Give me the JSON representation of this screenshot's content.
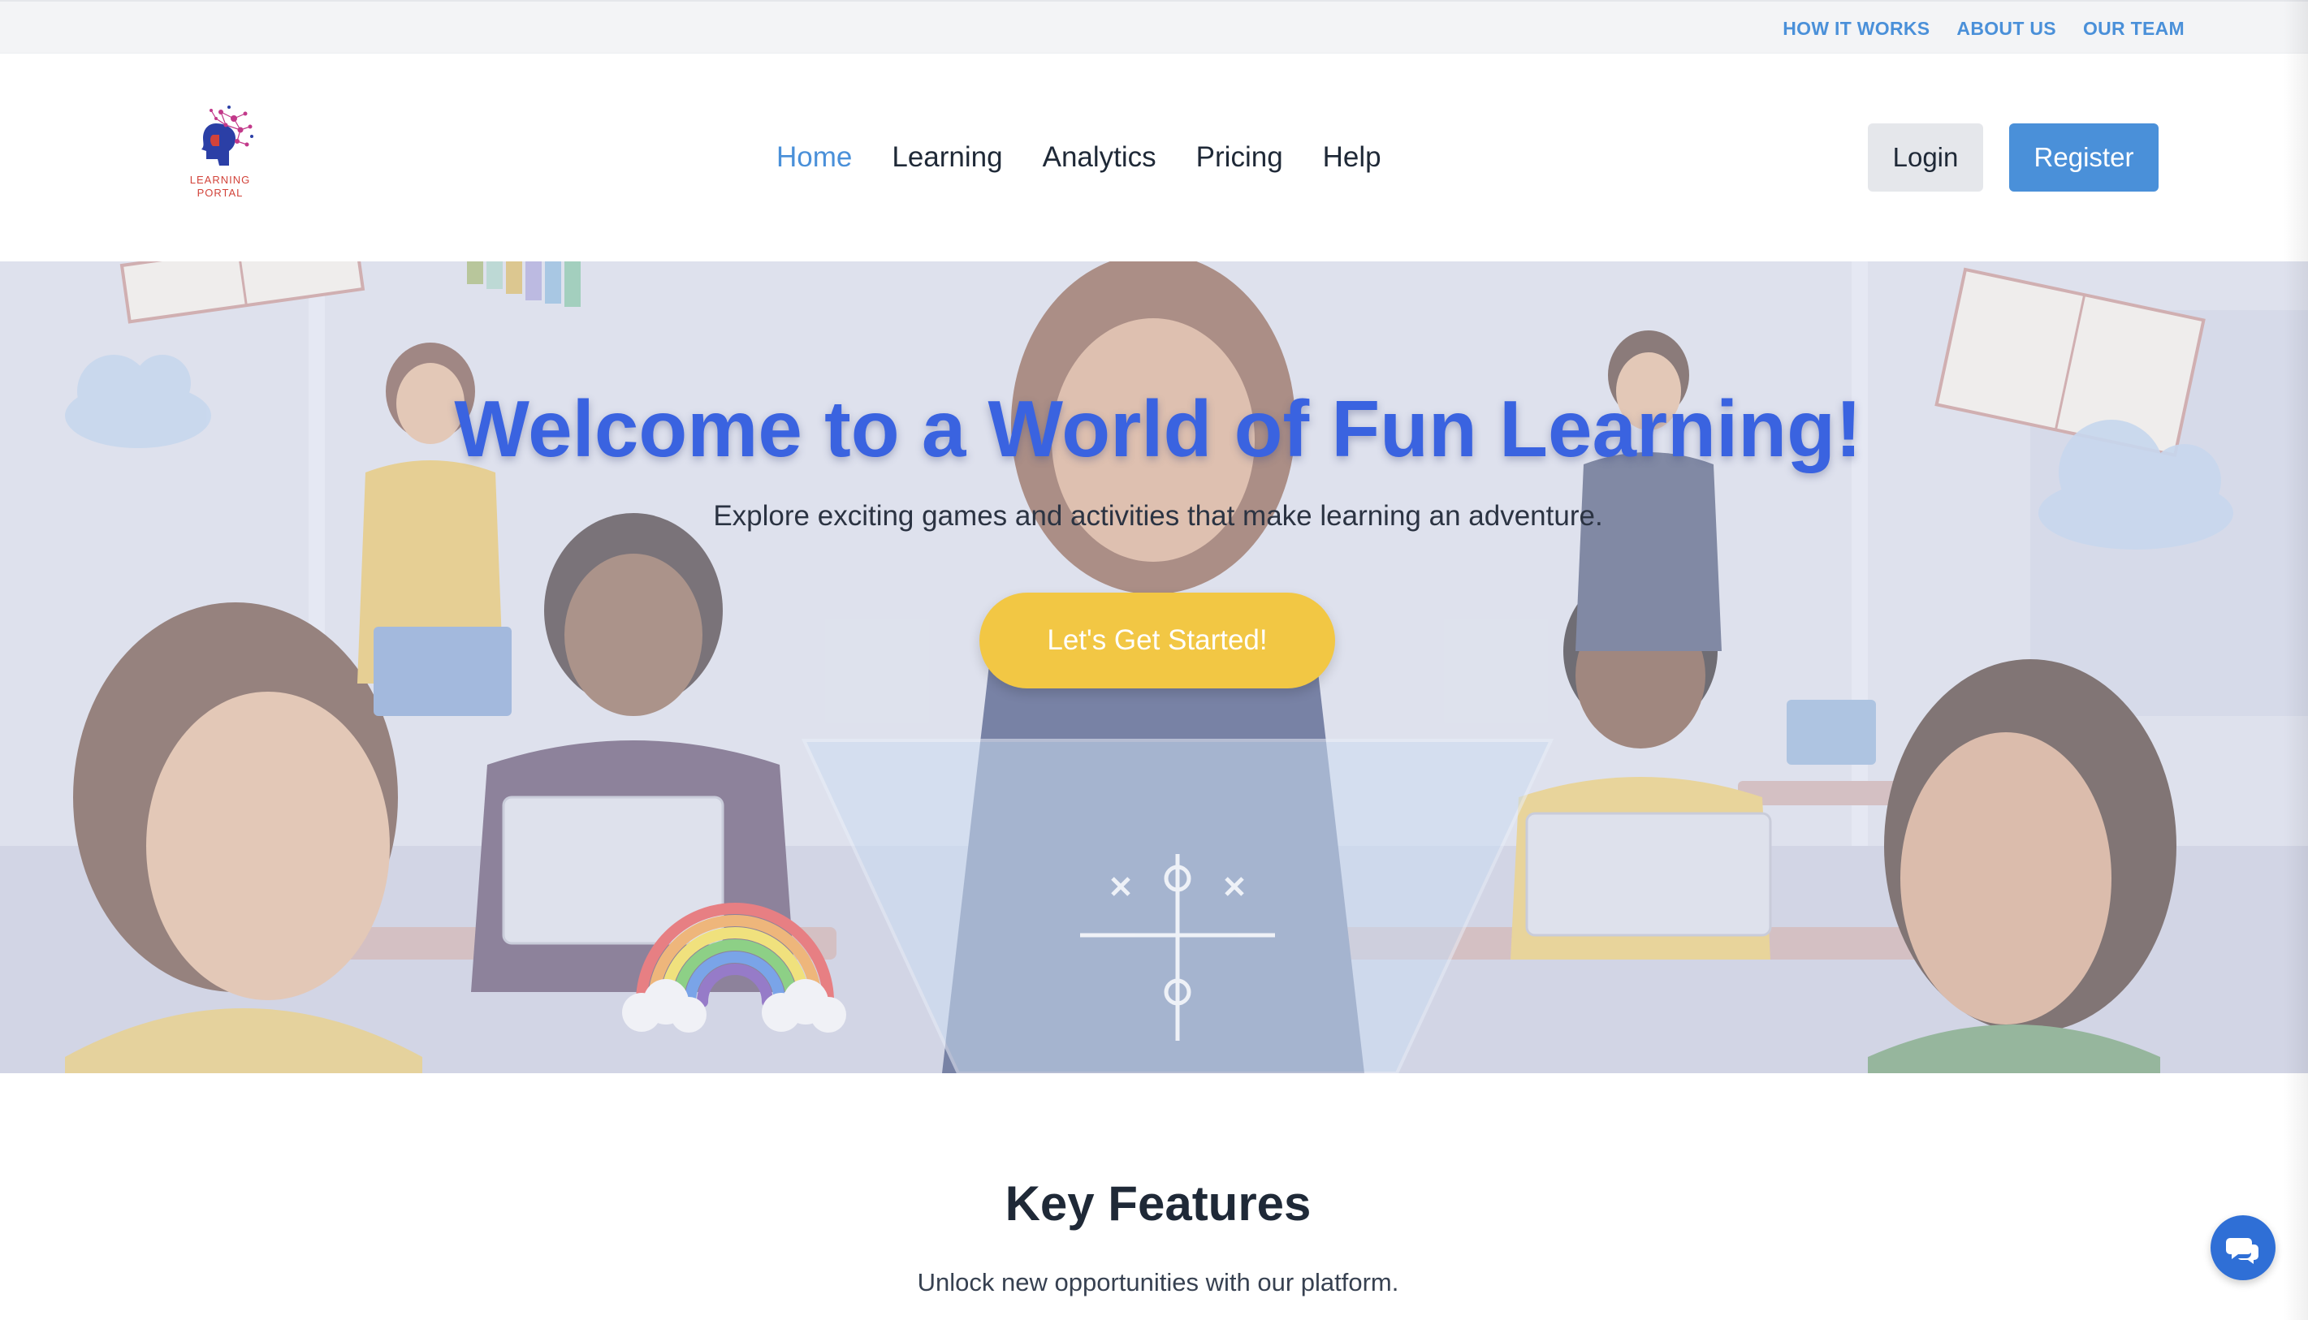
{
  "topbar": {
    "links": [
      "HOW IT WORKS",
      "ABOUT US",
      "OUR TEAM"
    ],
    "link_color": "#4a90d9"
  },
  "header": {
    "logo_text_line1": "LEARNING",
    "logo_text_line2": "PORTAL",
    "logo_icon": "brain-head-icon",
    "nav": [
      "Home",
      "Learning",
      "Analytics",
      "Pricing",
      "Help"
    ],
    "active_nav": "Home",
    "login_label": "Login",
    "register_label": "Register"
  },
  "hero": {
    "title": "Welcome to a World of Fun Learning!",
    "subtitle": "Explore exciting games and activities that make learning an adventure.",
    "cta_label": "Let's Get Started!",
    "background_image": "classroom-illustration",
    "title_color": "#3a63e0",
    "cta_color": "#f2c744"
  },
  "features": {
    "title": "Key Features",
    "subtitle": "Unlock new opportunities with our platform."
  },
  "chat": {
    "icon": "chat-bubbles-icon",
    "color": "#2f6fd6"
  }
}
